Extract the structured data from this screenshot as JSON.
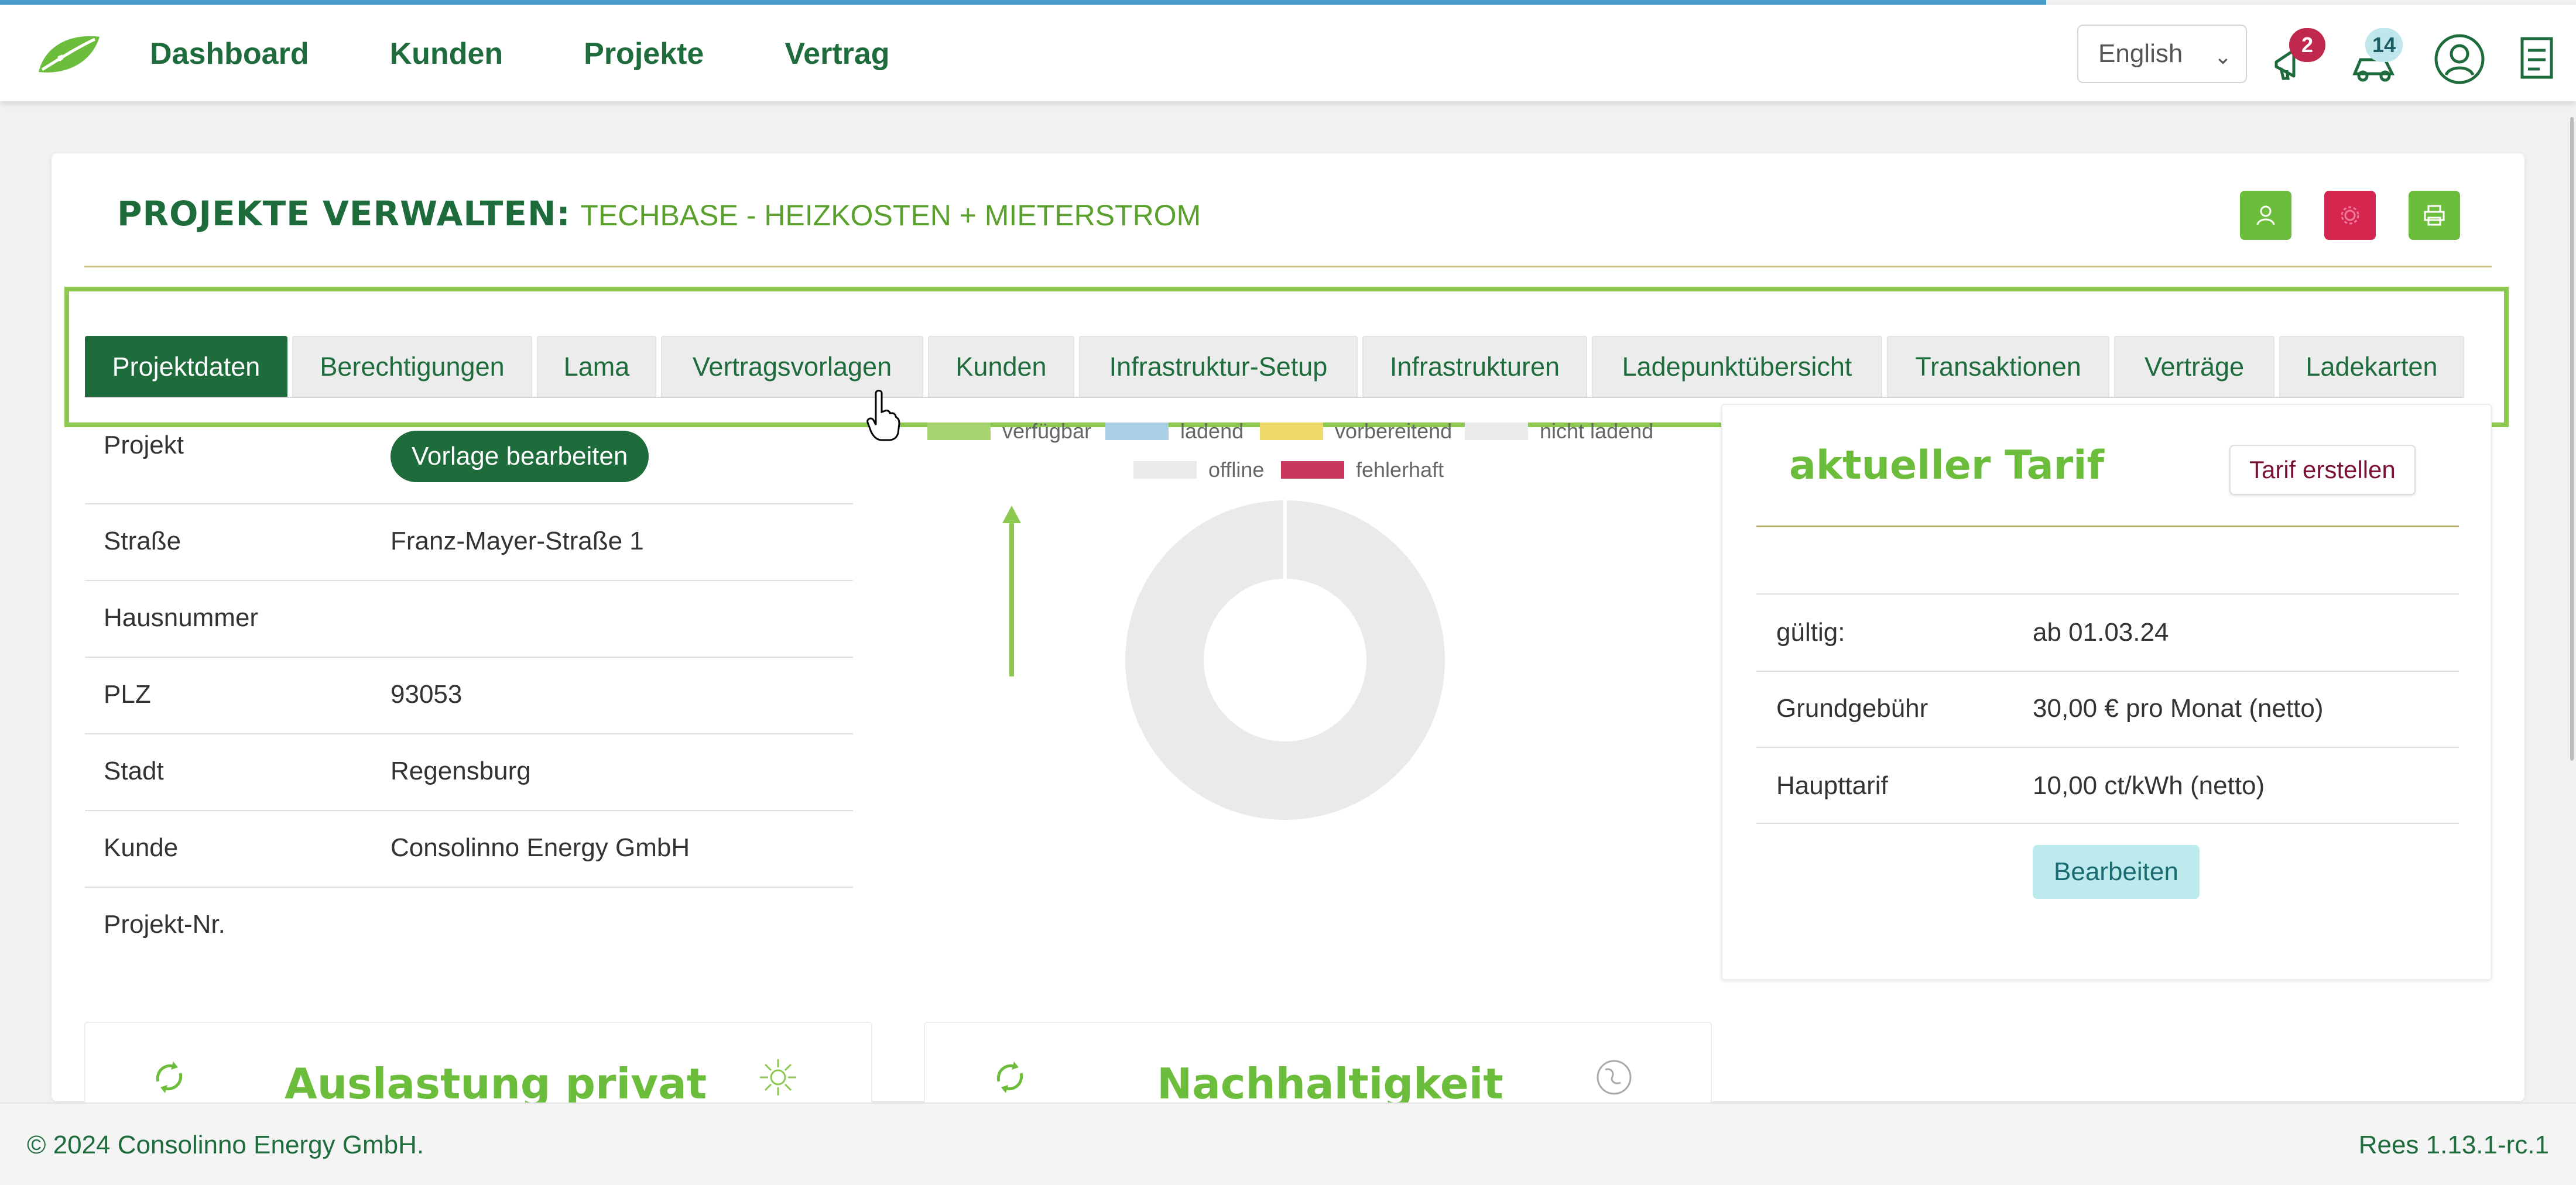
{
  "header": {
    "nav": [
      "Dashboard",
      "Kunden",
      "Projekte",
      "Vertrag"
    ],
    "language": "English",
    "notifications_count": "2",
    "messages_count": "14"
  },
  "page": {
    "title_bold": "PROJEKTE VERWALTEN:",
    "title_sub": "TECHBASE - HEIZKOSTEN + MIETERSTROM"
  },
  "tabs": [
    "Projektdaten",
    "Berechtigungen",
    "Lama",
    "Vertragsvorlagen",
    "Kunden",
    "Infrastruktur-Setup",
    "Infrastrukturen",
    "Ladepunktübersicht",
    "Transaktionen",
    "Verträge",
    "Ladekarten"
  ],
  "project": {
    "button": "Vorlage bearbeiten",
    "rows": [
      {
        "label": "Projekt",
        "value": ""
      },
      {
        "label": "Straße",
        "value": "Franz-Mayer-Straße 1"
      },
      {
        "label": "Hausnummer",
        "value": ""
      },
      {
        "label": "PLZ",
        "value": "93053"
      },
      {
        "label": "Stadt",
        "value": "Regensburg"
      },
      {
        "label": "Kunde",
        "value": "Consolinno Energy GmbH"
      },
      {
        "label": "Projekt-Nr.",
        "value": ""
      }
    ]
  },
  "chart_data": {
    "type": "pie",
    "legend": [
      {
        "name": "verfügbar",
        "color": "#a8d46f"
      },
      {
        "name": "ladend",
        "color": "#a9d0e6"
      },
      {
        "name": "vorbereitend",
        "color": "#f0d96b"
      },
      {
        "name": "nicht ladend",
        "color": "#e8eaeb"
      },
      {
        "name": "offline",
        "color": "#e8eaeb"
      },
      {
        "name": "fehlerhaft",
        "color": "#c9375f"
      }
    ],
    "values": [
      0,
      0,
      0,
      0,
      0,
      0
    ],
    "legend_position": "top"
  },
  "tarif": {
    "title": "aktueller Tarif",
    "create_button": "Tarif erstellen",
    "rows": [
      {
        "label": "gültig:",
        "value": "ab 01.03.24"
      },
      {
        "label": "Grundgebühr",
        "value": "30,00 € pro Monat (netto)"
      },
      {
        "label": "Haupttarif",
        "value": "10,00 ct/kWh (netto)"
      }
    ],
    "edit_button": "Bearbeiten"
  },
  "cards": {
    "left_title": "Auslastung privat",
    "right_title": "Nachhaltigkeit"
  },
  "footer": {
    "copyright": "© 2024 Consolinno Energy GmbH.",
    "version": "Rees 1.13.1-rc.1"
  }
}
